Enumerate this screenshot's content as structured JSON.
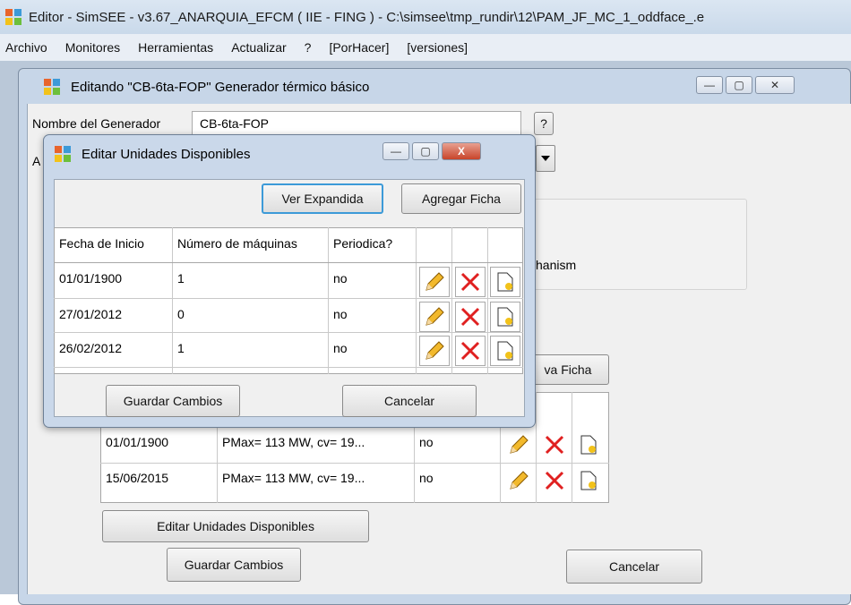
{
  "app": {
    "title": "Editor - SimSEE - v3.67_ANARQUIA_EFCM ( IIE - FING ) - C:\\simsee\\tmp_rundir\\12\\PAM_JF_MC_1_oddface_.e"
  },
  "menu": [
    "Archivo",
    "Monitores",
    "Herramientas",
    "Actualizar",
    "?",
    "[PorHacer]",
    "[versiones]"
  ],
  "gen": {
    "title": "Editando \"CB-6ta-FOP\" Generador térmico básico",
    "name_label": "Nombre del Generador",
    "name_value": "CB-6ta-FOP",
    "help_label": "?",
    "partial_label": "A",
    "partial_text": "hanism",
    "nueva_ficha_label": "va Ficha",
    "rows": [
      {
        "date": "01/01/1900",
        "desc": "PMax= 113 MW, cv= 19...",
        "periodic": "no"
      },
      {
        "date": "15/06/2015",
        "desc": "PMax= 113 MW, cv= 19...",
        "periodic": "no"
      }
    ],
    "edit_units_label": "Editar Unidades Disponibles",
    "save_label": "Guardar Cambios",
    "cancel_label": "Cancelar",
    "min_glyph": "—",
    "max_glyph": "▢",
    "close_glyph": "✕"
  },
  "ud": {
    "title": "Editar Unidades Disponibles",
    "view_expanded_label": "Ver Expandida",
    "add_label": "Agregar Ficha",
    "headers": [
      "Fecha de Inicio",
      "Número de máquinas",
      "Periodica?"
    ],
    "rows": [
      {
        "date": "01/01/1900",
        "machines": "1",
        "periodic": "no"
      },
      {
        "date": "27/01/2012",
        "machines": "0",
        "periodic": "no"
      },
      {
        "date": "26/02/2012",
        "machines": "1",
        "periodic": "no"
      }
    ],
    "save_label": "Guardar Cambios",
    "cancel_label": "Cancelar",
    "min_glyph": "—",
    "max_glyph": "▢",
    "close_glyph": "X"
  },
  "colors": {
    "accent_blue": "#3c9ad8",
    "delete_red": "#e02020"
  },
  "icons": [
    "edit-pencil-icon",
    "delete-x-icon",
    "copy-doc-icon",
    "dropdown-arrow-icon"
  ]
}
